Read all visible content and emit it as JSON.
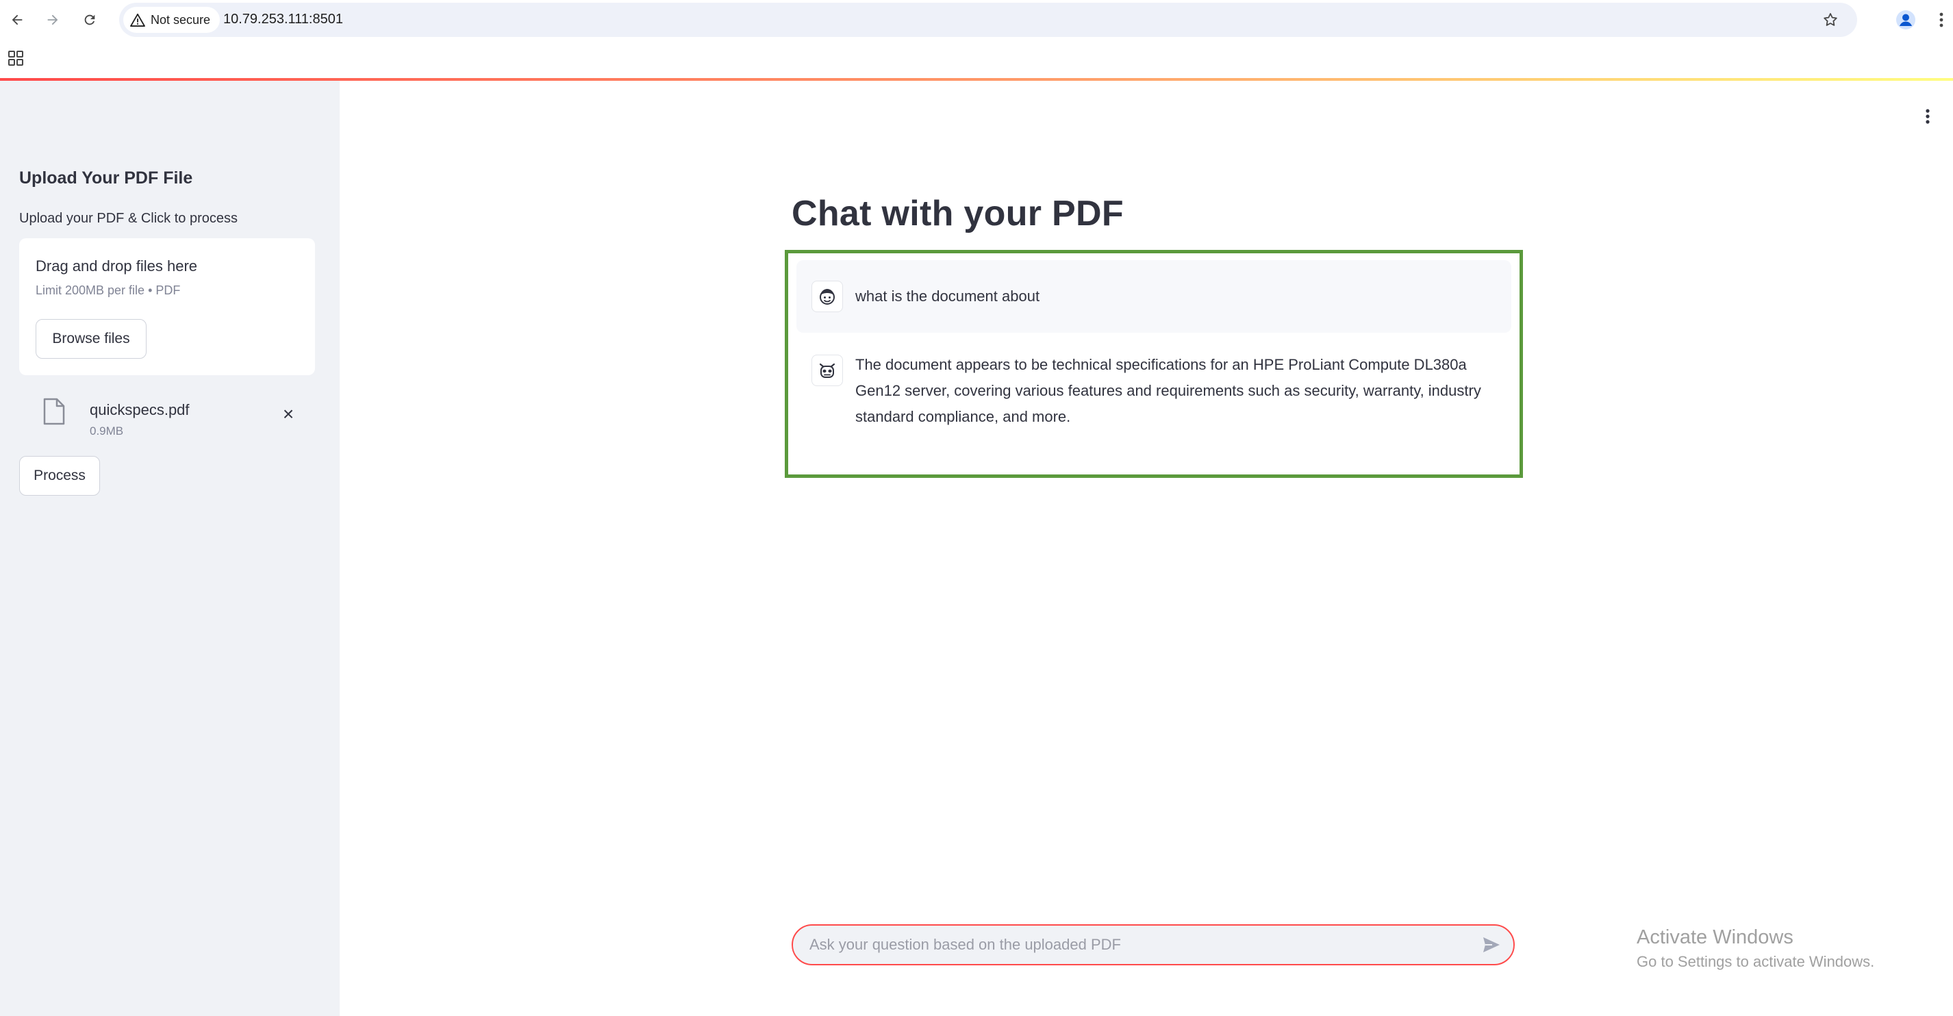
{
  "browser": {
    "security_label": "Not secure",
    "url": "10.79.253.111:8501"
  },
  "sidebar": {
    "title": "Upload Your PDF File",
    "subtitle": "Upload your PDF & Click to process",
    "dropzone": {
      "title": "Drag and drop files here",
      "limit": "Limit 200MB per file • PDF",
      "browse_label": "Browse files"
    },
    "file": {
      "name": "quickspecs.pdf",
      "size": "0.9MB",
      "remove_icon": "×"
    },
    "process_label": "Process"
  },
  "main": {
    "title": "Chat with your PDF",
    "messages": [
      {
        "role": "user",
        "avatar_icon": "user-avatar-icon",
        "text": "what is the document about"
      },
      {
        "role": "assistant",
        "avatar_icon": "assistant-avatar-icon",
        "text": "The document appears to be technical specifications for an HPE ProLiant Compute DL380a Gen12 server, covering various features and requirements such as security, warranty, industry standard compliance, and more."
      }
    ],
    "chat_input": {
      "placeholder": "Ask your question based on the uploaded PDF",
      "value": ""
    }
  },
  "watermark": {
    "title": "Activate Windows",
    "subtitle": "Go to Settings to activate Windows."
  },
  "colors": {
    "accent": "#ff4b4b",
    "highlight_border": "#5b9a3c",
    "sidebar_bg": "#f0f2f6",
    "text": "#31333f"
  }
}
